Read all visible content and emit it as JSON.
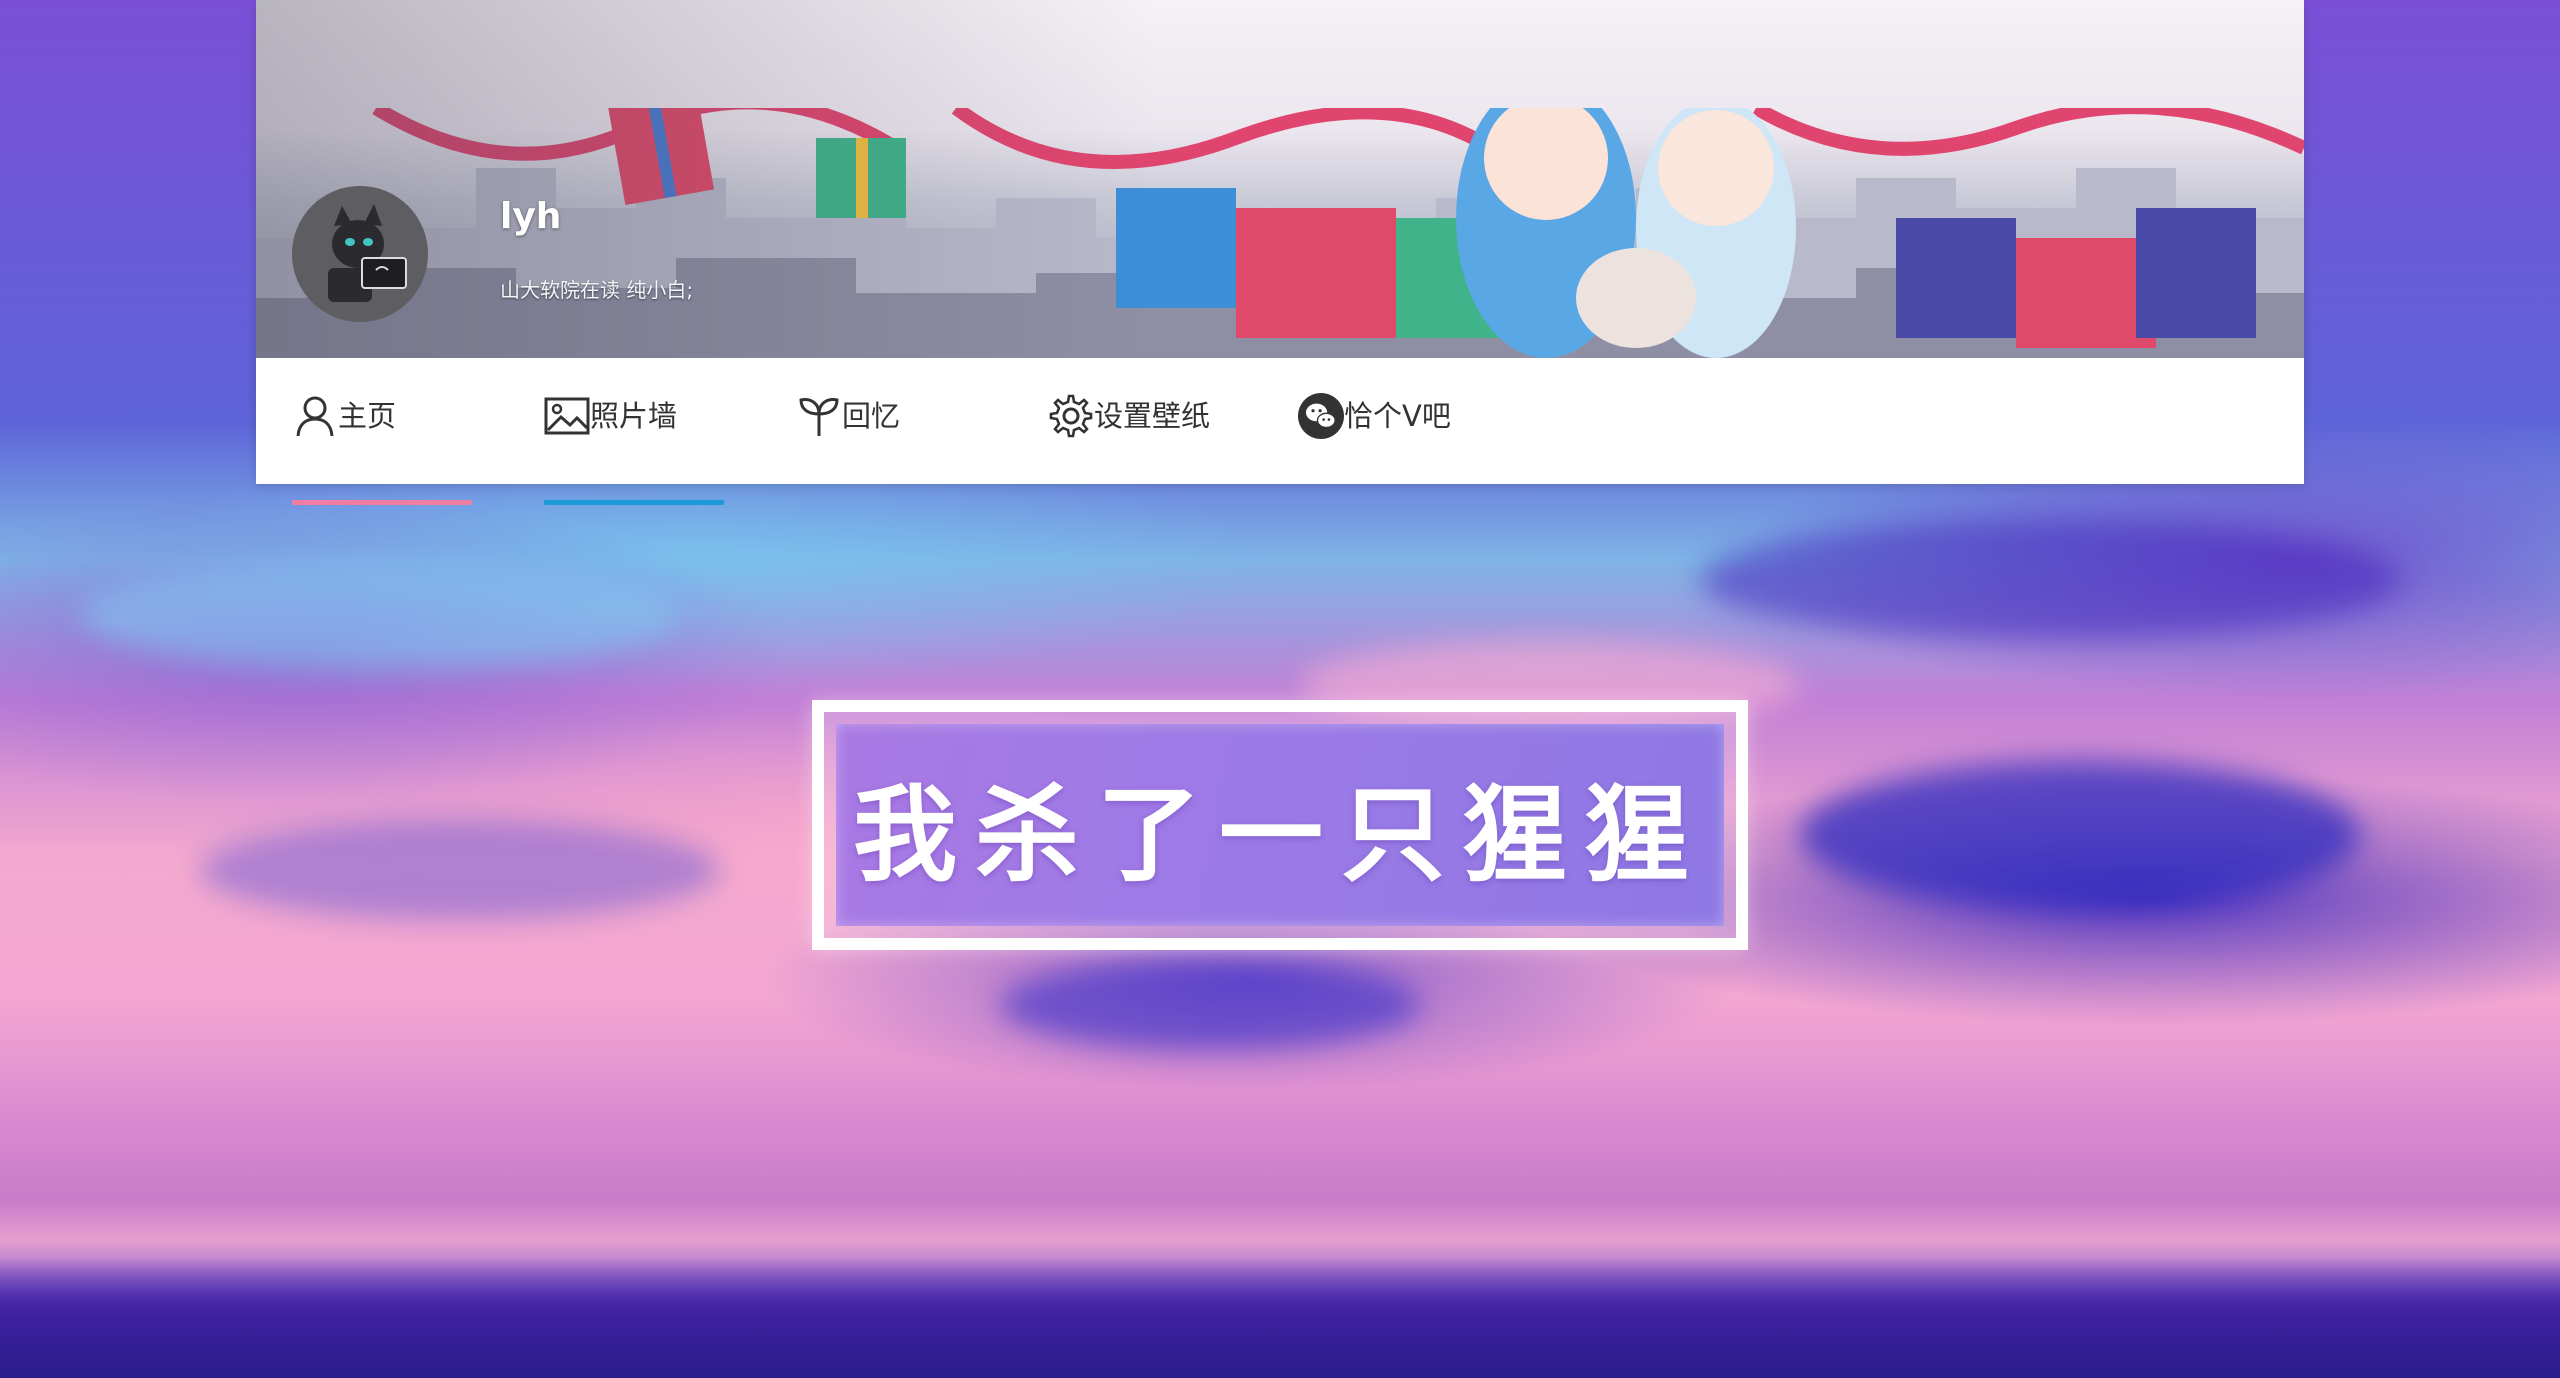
{
  "profile": {
    "username": "lyh",
    "bio": "山大软院在读 纯小白;"
  },
  "nav": {
    "items": [
      {
        "label": "主页",
        "icon": "user-icon",
        "active_color": "#f07ea3"
      },
      {
        "label": "照片墙",
        "icon": "image-icon",
        "active_color": "#1a9ad8"
      },
      {
        "label": "回忆",
        "icon": "sprout-icon"
      },
      {
        "label": "设置壁纸",
        "icon": "gear-icon"
      },
      {
        "label": "恰个V吧",
        "icon": "wechat-icon"
      }
    ]
  },
  "hero": {
    "title": "我杀了一只猩猩"
  },
  "colors": {
    "accent_pink": "#f07ea3",
    "accent_blue": "#1a9ad8",
    "title_box": "#9c7ae6"
  }
}
